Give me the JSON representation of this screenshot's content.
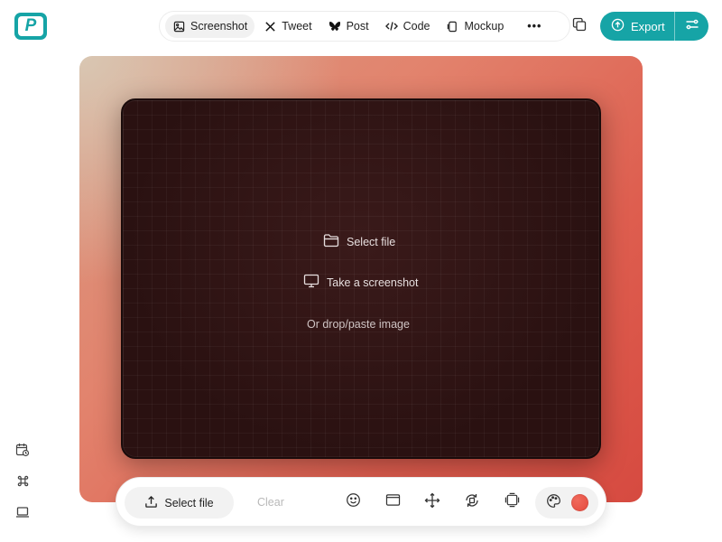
{
  "header": {
    "logo_letter": "P",
    "tabs": [
      {
        "label": "Screenshot",
        "icon": "image-icon",
        "active": true
      },
      {
        "label": "Tweet",
        "icon": "x-logo-icon",
        "active": false
      },
      {
        "label": "Post",
        "icon": "butterfly-icon",
        "active": false
      },
      {
        "label": "Code",
        "icon": "code-icon",
        "active": false
      },
      {
        "label": "Mockup",
        "icon": "device-icon",
        "active": false
      }
    ],
    "more_label": "•••",
    "export_label": "Export"
  },
  "canvas": {
    "select_file": "Select file",
    "take_screenshot": "Take a screenshot",
    "drop_hint": "Or drop/paste image"
  },
  "sidebar": {
    "icons": [
      "calendar-clock-icon",
      "command-icon",
      "laptop-icon"
    ]
  },
  "toolbar": {
    "select_file": "Select file",
    "clear": "Clear",
    "icons": [
      "smiley-icon",
      "window-icon",
      "move-icon",
      "rotate-icon",
      "layers-icon",
      "palette-icon"
    ],
    "swatch_color": "#e5483c"
  },
  "colors": {
    "accent": "#16a4a6",
    "frame": "#2c1414",
    "gradient_start": "#d9c7b3",
    "gradient_end": "#d64a40"
  }
}
